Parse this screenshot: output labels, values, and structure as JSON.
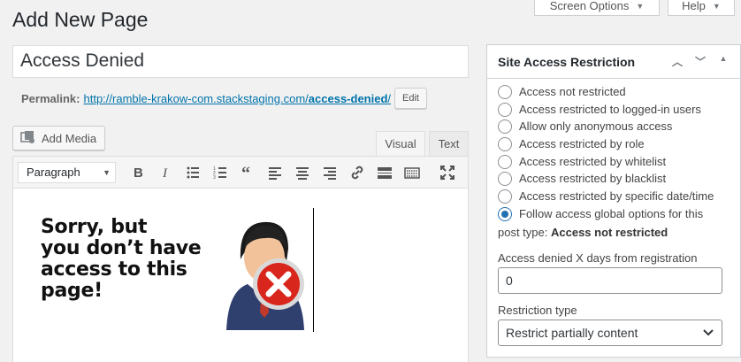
{
  "top_tabs": {
    "screen_options": "Screen Options",
    "help": "Help"
  },
  "page": {
    "title": "Add New Page"
  },
  "post": {
    "title_value": "Access Denied",
    "permalink_label": "Permalink:",
    "permalink_base": "http://ramble-krakow-com.stackstaging.com/",
    "permalink_slug": "access-denied",
    "permalink_trailing": "/",
    "edit_label": "Edit"
  },
  "editor": {
    "add_media_label": "Add Media",
    "tab_visual": "Visual",
    "tab_text": "Text",
    "format_value": "Paragraph",
    "toolbar_icons": [
      "bold-icon",
      "italic-icon",
      "bullet-list-icon",
      "numbered-list-icon",
      "blockquote-icon",
      "align-left-icon",
      "align-center-icon",
      "align-right-icon",
      "link-icon",
      "read-more-icon",
      "toolbar-toggle-icon",
      "fullscreen-icon"
    ],
    "image_text_lines": [
      "Sorry, but",
      "you don’t have",
      "access to this",
      "page!"
    ]
  },
  "panel": {
    "title": "Site Access Restriction",
    "options": [
      {
        "label": "Access not restricted",
        "checked": false
      },
      {
        "label": "Access restricted to logged-in users",
        "checked": false
      },
      {
        "label": "Allow only anonymous access",
        "checked": false
      },
      {
        "label": "Access restricted by role",
        "checked": false
      },
      {
        "label": "Access restricted by whitelist",
        "checked": false
      },
      {
        "label": "Access restricted by blacklist",
        "checked": false
      },
      {
        "label": "Access restricted by specific date/time",
        "checked": false
      },
      {
        "label": "Follow access global options for this",
        "checked": true
      }
    ],
    "option_continuation_prefix": "post type:",
    "option_continuation_value": "Access not restricted",
    "days_label": "Access denied X days from registration",
    "days_value": "0",
    "restriction_type_label": "Restriction type",
    "restriction_type_value": "Restrict partially content"
  },
  "colors": {
    "link": "#0073aa",
    "radio_checked": "#2271b1",
    "error_red": "#d9261c"
  }
}
